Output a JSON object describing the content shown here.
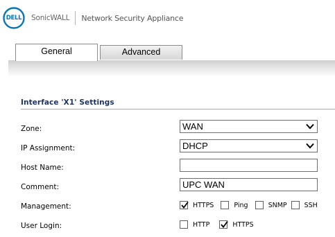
{
  "header": {
    "logo_text": "DELL",
    "brand": "SonicWALL",
    "product": "Network Security Appliance"
  },
  "tabs": [
    {
      "label": "General",
      "active": true
    },
    {
      "label": "Advanced",
      "active": false
    }
  ],
  "section": {
    "title": "Interface 'X1' Settings"
  },
  "fields": {
    "zone": {
      "label": "Zone:",
      "value": "WAN"
    },
    "ip_assignment": {
      "label": "IP Assignment:",
      "value": "DHCP"
    },
    "host_name": {
      "label": "Host Name:",
      "value": ""
    },
    "comment": {
      "label": "Comment:",
      "value": "UPC WAN"
    },
    "management": {
      "label": "Management:",
      "options": [
        {
          "label": "HTTPS",
          "checked": true
        },
        {
          "label": "Ping",
          "checked": false
        },
        {
          "label": "SNMP",
          "checked": false
        },
        {
          "label": "SSH",
          "checked": false
        }
      ]
    },
    "user_login": {
      "label": "User Login:",
      "options": [
        {
          "label": "HTTP",
          "checked": false
        },
        {
          "label": "HTTPS",
          "checked": true
        }
      ]
    }
  },
  "colors": {
    "logo_blue": "#0a76b7",
    "section_title": "#1b3364"
  }
}
